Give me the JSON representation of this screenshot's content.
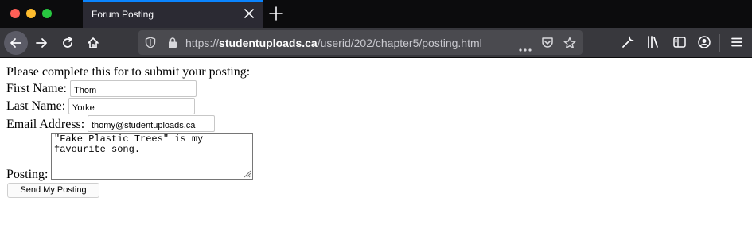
{
  "browser": {
    "tab": {
      "title": "Forum Posting"
    },
    "address_bar": {
      "url_prefix": "https://",
      "url_domain": "studentuploads.ca",
      "url_path": "/userid/202/chapter5/posting.html"
    },
    "icons": [
      "back-icon",
      "forward-icon",
      "reload-icon",
      "home-icon",
      "shield-icon",
      "lock-icon",
      "more-icon",
      "pocket-icon",
      "star-icon",
      "wrench-icon",
      "library-icon",
      "sidebar-icon",
      "account-icon",
      "menu-icon",
      "close-icon",
      "plus-icon"
    ]
  },
  "form": {
    "intro": "Please complete this for to submit your posting:",
    "first_name": {
      "label": "First Name:",
      "value": "Thom"
    },
    "last_name": {
      "label": "Last Name:",
      "value": "Yorke"
    },
    "email": {
      "label": "Email Address:",
      "value": "thomy@studentuploads.ca"
    },
    "posting": {
      "label": "Posting:",
      "value": "\"Fake Plastic Trees\" is my favourite song."
    },
    "submit_label": "Send My Posting"
  }
}
